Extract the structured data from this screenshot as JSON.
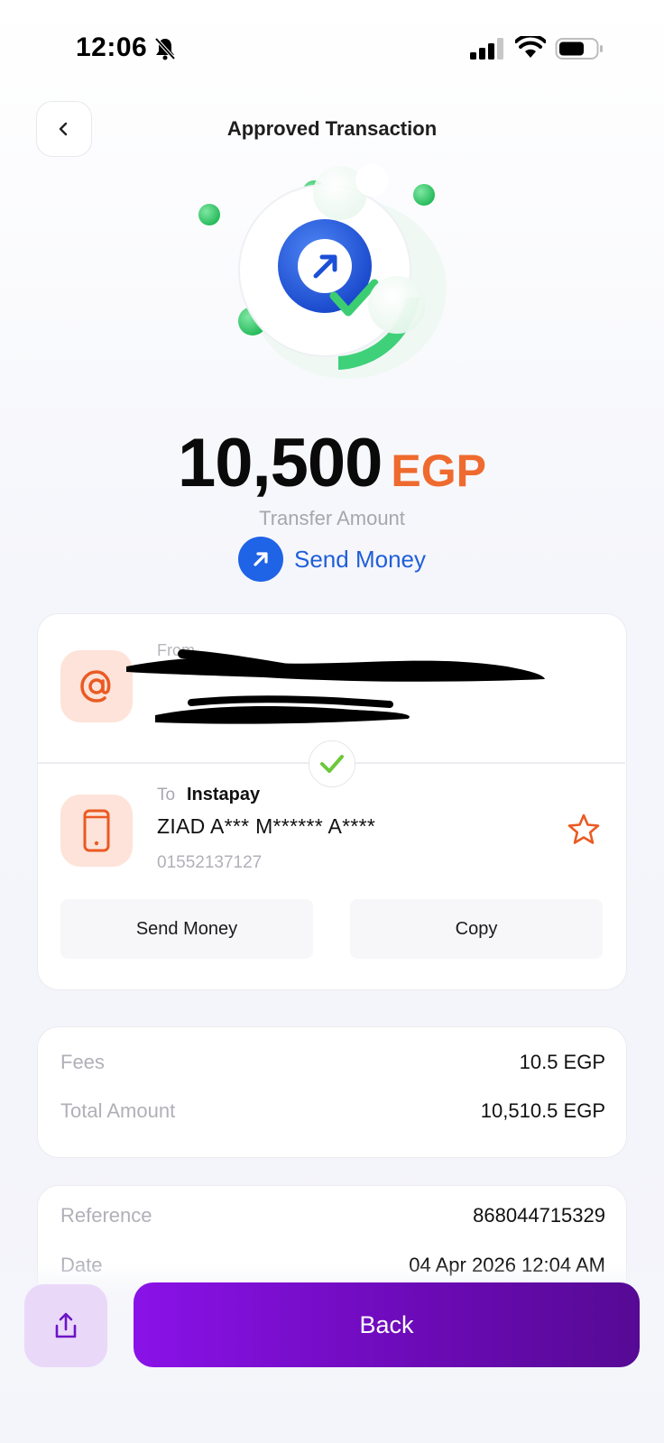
{
  "status_bar": {
    "time": "12:06",
    "bell_icon": "bell-slash-icon",
    "signal_icon": "cellular-signal-icon",
    "wifi_icon": "wifi-icon",
    "battery_icon": "battery-icon"
  },
  "header": {
    "title": "Approved Transaction",
    "back_icon": "chevron-left-icon"
  },
  "hero": {
    "icon": "send-success-illustration"
  },
  "amount": {
    "value": "10,500",
    "currency": "EGP",
    "label": "Transfer Amount"
  },
  "transaction_type": {
    "label": "Send Money",
    "icon": "arrow-up-right-icon"
  },
  "from": {
    "label": "From",
    "icon": "at-sign-icon"
  },
  "to": {
    "label": "To",
    "bank": "Instapay",
    "name": "ZIAD A*** M****** A****",
    "phone": "01552137127",
    "icon": "phone-icon"
  },
  "actions": {
    "send_money": "Send Money",
    "copy": "Copy"
  },
  "fees": [
    {
      "label": "Fees",
      "value": "10.5 EGP"
    },
    {
      "label": "Total Amount",
      "value": "10,510.5 EGP"
    }
  ],
  "reference": [
    {
      "label": "Reference",
      "value": "868044715329"
    },
    {
      "label": "Date",
      "value": "04 Apr 2026 12:04 AM"
    }
  ],
  "footer": {
    "back_label": "Back",
    "share_icon": "share-icon"
  },
  "colors": {
    "accent_orange": "#ef6a2f",
    "primary_blue": "#1f63e6",
    "purple": "#7a0fd0",
    "success_green": "#39c46b"
  }
}
